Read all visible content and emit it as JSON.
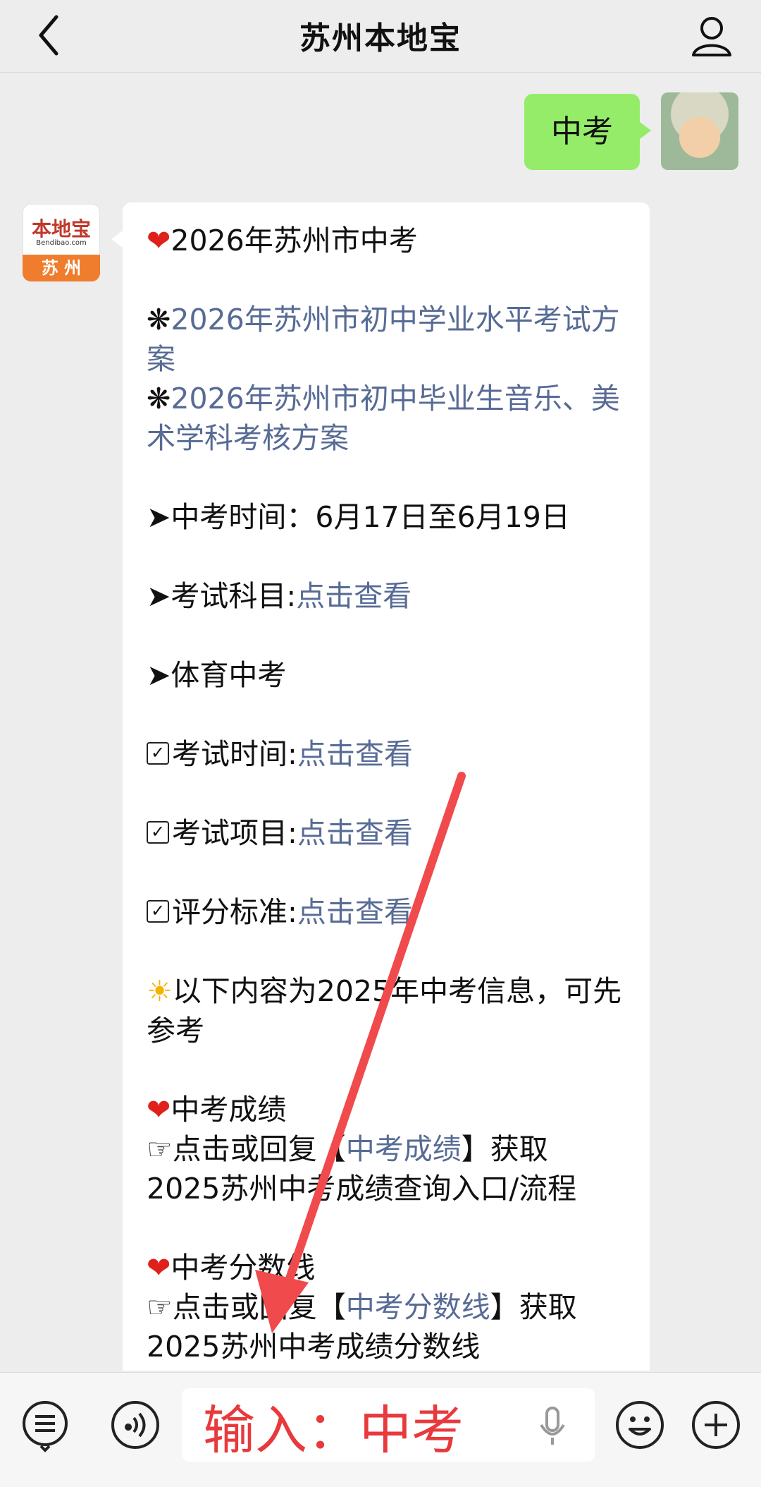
{
  "header": {
    "title": "苏州本地宝"
  },
  "me": {
    "message": "中考"
  },
  "bot": {
    "avatar": {
      "brand": "本地宝",
      "url": "Bendibao.com",
      "city": "苏 州"
    },
    "lines": {
      "title": "2026年苏州市中考",
      "link1": "2026年苏州市初中学业水平考试方案",
      "link2": "2026年苏州市初中毕业生音乐、美术学科考核方案",
      "exam_time_label": "中考时间：6月17日至6月19日",
      "subjects_label": "考试科目:",
      "subjects_link": "点击查看",
      "pe_label": "体育中考",
      "pe_time_label": "考试时间:",
      "pe_time_link": "点击查看",
      "pe_items_label": "考试项目:",
      "pe_items_link": "点击查看",
      "pe_score_label": "评分标准:",
      "pe_score_link": "点击查看",
      "notice": "以下内容为2025年中考信息，可先参考",
      "score_title": "中考成绩",
      "score_pre": "点击或回复【",
      "score_link": "中考成绩",
      "score_post": "】获取",
      "score_desc": "2025苏州中考成绩查询入口/流程",
      "line_title": "中考分数线",
      "line_pre": "点击或回复【",
      "line_link": "中考分数线",
      "line_post": "】获取",
      "line_desc": "2025苏州中考成绩分数线"
    }
  },
  "input": {
    "annotation": "输入：中考"
  },
  "colors": {
    "my_bubble": "#95ec69",
    "link": "#576b95",
    "arrow": "#f04a4c",
    "annotation": "#e8393c"
  },
  "icons": [
    "back-icon",
    "profile-icon",
    "menu-icon",
    "voice-icon",
    "mic-icon",
    "emoji-icon",
    "plus-icon"
  ]
}
